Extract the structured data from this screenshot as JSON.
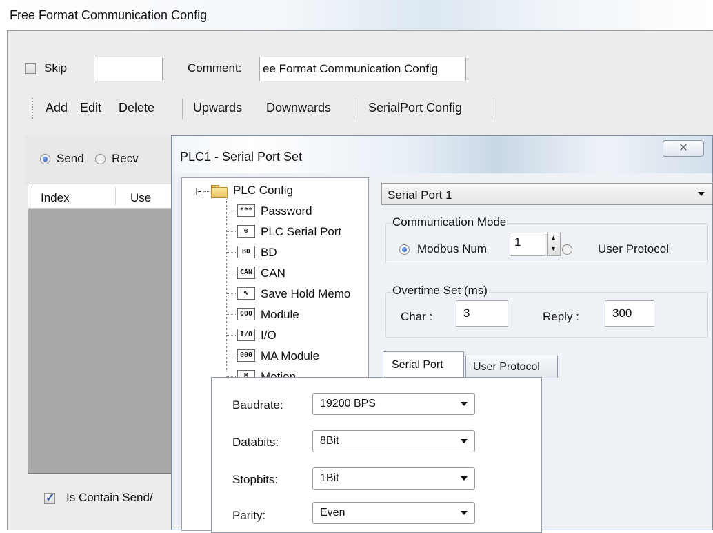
{
  "outer": {
    "title": "Free Format Communication Config",
    "skip_label": "Skip",
    "comment_label": "Comment:",
    "comment_value": "ee Format Communication Config",
    "toolbar": {
      "add": "Add",
      "edit": "Edit",
      "delete": "Delete",
      "upwards": "Upwards",
      "downwards": "Downwards",
      "serialport_config": "SerialPort Config"
    },
    "send_label": "Send",
    "recv_label": "Recv",
    "table_headers": [
      "Index",
      "Use"
    ],
    "contain_label": "Is Contain Send/"
  },
  "dialog": {
    "title": "PLC1 - Serial Port  Set",
    "close_glyph": "✕",
    "tree": {
      "root": "PLC Config",
      "items": [
        {
          "label": "Password",
          "icon": "password-icon",
          "glyph": "***"
        },
        {
          "label": "PLC Serial Port",
          "icon": "serial-port-icon",
          "glyph": "⊕"
        },
        {
          "label": "BD",
          "icon": "bd-icon",
          "glyph": "BD"
        },
        {
          "label": "CAN",
          "icon": "can-icon",
          "glyph": "CAN"
        },
        {
          "label": "Save Hold Memo",
          "icon": "memo-wave-icon",
          "glyph": "∿"
        },
        {
          "label": "Module",
          "icon": "module-icon",
          "glyph": "000"
        },
        {
          "label": "I/O",
          "icon": "io-icon",
          "glyph": "I/O"
        },
        {
          "label": "MA Module",
          "icon": "ma-module-icon",
          "glyph": "000"
        },
        {
          "label": "Motion",
          "icon": "motion-icon",
          "glyph": "M"
        }
      ]
    },
    "port_select": "Serial Port 1",
    "comm_mode": {
      "label": "Communication Mode",
      "modbus_label": "Modbus Num",
      "modbus_value": "1",
      "user_protocol_label": "User Protocol"
    },
    "overtime": {
      "label": "Overtime Set (ms)",
      "char_label": "Char :",
      "char_value": "3",
      "reply_label": "Reply :",
      "reply_value": "300"
    },
    "tabs": [
      "Serial Port",
      "User Protocol"
    ],
    "serial": {
      "baudrate_label": "Baudrate:",
      "baudrate_value": "19200 BPS",
      "databits_label": "Databits:",
      "databits_value": "8Bit",
      "stopbits_label": "Stopbits:",
      "stopbits_value": "1Bit",
      "parity_label": "Parity:",
      "parity_value": "Even"
    }
  }
}
